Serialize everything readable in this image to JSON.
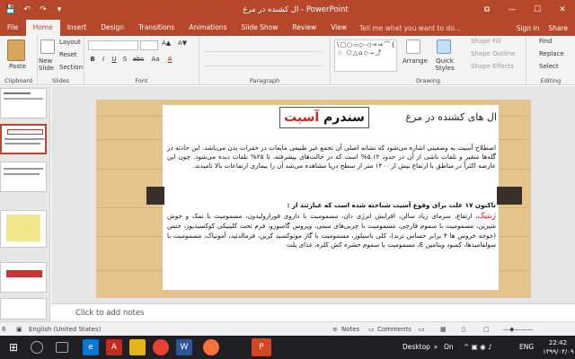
{
  "window": {
    "title": "ال  کشنده در مرغ  -  PowerPoint"
  },
  "qat": {
    "save_glyph": "💾",
    "undo_glyph": "↶",
    "redo_glyph": "↷",
    "customize_glyph": "▾"
  },
  "window_controls": {
    "restore_glyph": "⧉",
    "minimize_glyph": "—",
    "maximize_glyph": "☐",
    "close_glyph": "✕"
  },
  "tabs": [
    "File",
    "Home",
    "Insert",
    "Design",
    "Transitions",
    "Animations",
    "Slide Show",
    "Review",
    "View"
  ],
  "tell_me": "Tell me what you want to do...",
  "signin": "Sign in",
  "share": "Share",
  "ribbon": {
    "clipboard": {
      "paste": "Paste",
      "label": "Clipboard"
    },
    "slides": {
      "new_slide": "New Slide",
      "layout": "Layout",
      "reset": "Reset",
      "section": "Section",
      "label": "Slides"
    },
    "font": {
      "label": "Font",
      "bold": "B",
      "italic": "I",
      "underline": "U",
      "shadow": "S",
      "strike": "abc",
      "case": "Aa",
      "grow": "A▲",
      "shrink": "A▼",
      "color": "A"
    },
    "paragraph": {
      "label": "Paragraph"
    },
    "drawing": {
      "shape_glyphs": "\\□○▭▷◁→⇒⌒{}☆ ⬠△⌂◇⭢⤴",
      "arrange": "Arrange",
      "quick_styles": "Quick Styles",
      "shape_fill": "Shape Fill",
      "shape_outline": "Shape Outline",
      "shape_effects": "Shape Effects",
      "label": "Drawing"
    },
    "editing": {
      "find": "Find",
      "replace": "Replace",
      "select": "Select",
      "label": "Editing"
    }
  },
  "slide": {
    "title_black": "سندرم",
    "title_red": "آسیت",
    "heading": "ال های کشنده در مرغ",
    "para1": "اصطلاح آسیت به وضعیتی اشاره می‌شود که نشانه اصلی آن تجمع غیر طبیعی مایعات در حفرات بدن می‌باشد. این حادثه در گله‌ها متغیر و تلفات ناشی از آن در حدود ۵.۱۲% است که در حالت‌های پیشرفته، تا ۲۵% تلفات دیده می‌شود. چون این عارضه اکثراً در مناطق با ارتفاع بیش از ۱۴۰۰ متر از سطح دریا مشاهده می‌شد آن را بیماری ارتفاعات بالا نامیدند.",
    "para2": "تاکنون ۱۷ علت برای وقوع آسیت شناخته شده است که عبارتند از :",
    "para3_red": "ژنتیک",
    "para3": "، ارتفاع، سرمای زیاد سالن، افزایش انرژی دان، مسمومیت با داروی فورازولیدون، مسمومیت با نمک و جوش شیرین، مسمومیت با سموم قارچی، مسمومیت با چربی‌های سمی، ویروس گامبورو، فرم تحت کلینیکی کوکسیدیوز، جنس (جوجه خروس ها ۴ برابر حساس ترند)، کلی باسیلوز، مسمومیت با گاز مونوکسید کربن، فرمالدئید، آمونیاک، مسمومیت با سولفامیدها، کمبود ویتامین E، مسمومیت با سموم حشره کش کلره، غذای پلت"
  },
  "notes": {
    "placeholder": "Click to add notes"
  },
  "status": {
    "slide_num": "6",
    "language": "English (United States)",
    "notes": "Notes",
    "comments": "Comments"
  },
  "taskbar": {
    "desktop": "Desktop",
    "on_label": "On",
    "language": "ENG",
    "time": "22:42",
    "date": "۱۳۹۹/۰۴/۰۹"
  },
  "colors": {
    "accent": "#b7472a",
    "title_red": "#d81e1e",
    "frame": "#e5c48c",
    "tab_dark": "#3a302a"
  }
}
